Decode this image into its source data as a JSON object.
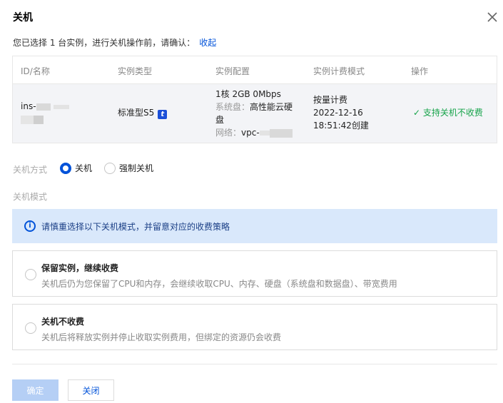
{
  "dialog": {
    "title": "关机",
    "confirm_text": "您已选择 1 台实例，进行关机操作前，请确认：",
    "collapse_link": "收起"
  },
  "table": {
    "headers": [
      "ID/名称",
      "实例类型",
      "实例配置",
      "实例计费模式",
      "操作"
    ],
    "row": {
      "id_prefix": "ins-",
      "type": "标准型S5",
      "type_badge": "t",
      "config_spec": "1核 2GB 0Mbps",
      "config_disk_label": "系统盘：",
      "config_disk_value": "高性能云硬",
      "config_disk_value2": "盘",
      "config_network_label": "网络：",
      "config_network_value": "vpc-",
      "billing_mode": "按量计费",
      "billing_date": "2022-12-16",
      "billing_time": "18:51:42创建",
      "action_icon": "check-icon",
      "action_text": "支持关机不收费"
    }
  },
  "shutdown_method": {
    "label": "关机方式",
    "options": [
      {
        "label": "关机",
        "checked": true
      },
      {
        "label": "强制关机",
        "checked": false
      }
    ]
  },
  "shutdown_mode": {
    "label": "关机模式",
    "alert_icon": "info-icon",
    "alert_text": "请慎重选择以下关机模式，并留意对应的收费策略",
    "cards": [
      {
        "title": "保留实例，继续收费",
        "desc": "关机后仍为您保留了CPU和内存，会继续收取CPU、内存、硬盘（系统盘和数据盘）、带宽费用"
      },
      {
        "title": "关机不收费",
        "desc": "关机后将释放实例并停止收取实例费用，但绑定的资源仍会收费"
      }
    ]
  },
  "footer": {
    "ok_label": "确定",
    "close_label": "关闭"
  },
  "colors": {
    "primary": "#0052d9",
    "primary_disabled": "#b5cff5",
    "success": "#16a34a",
    "alert_bg": "#d9e8fb"
  }
}
